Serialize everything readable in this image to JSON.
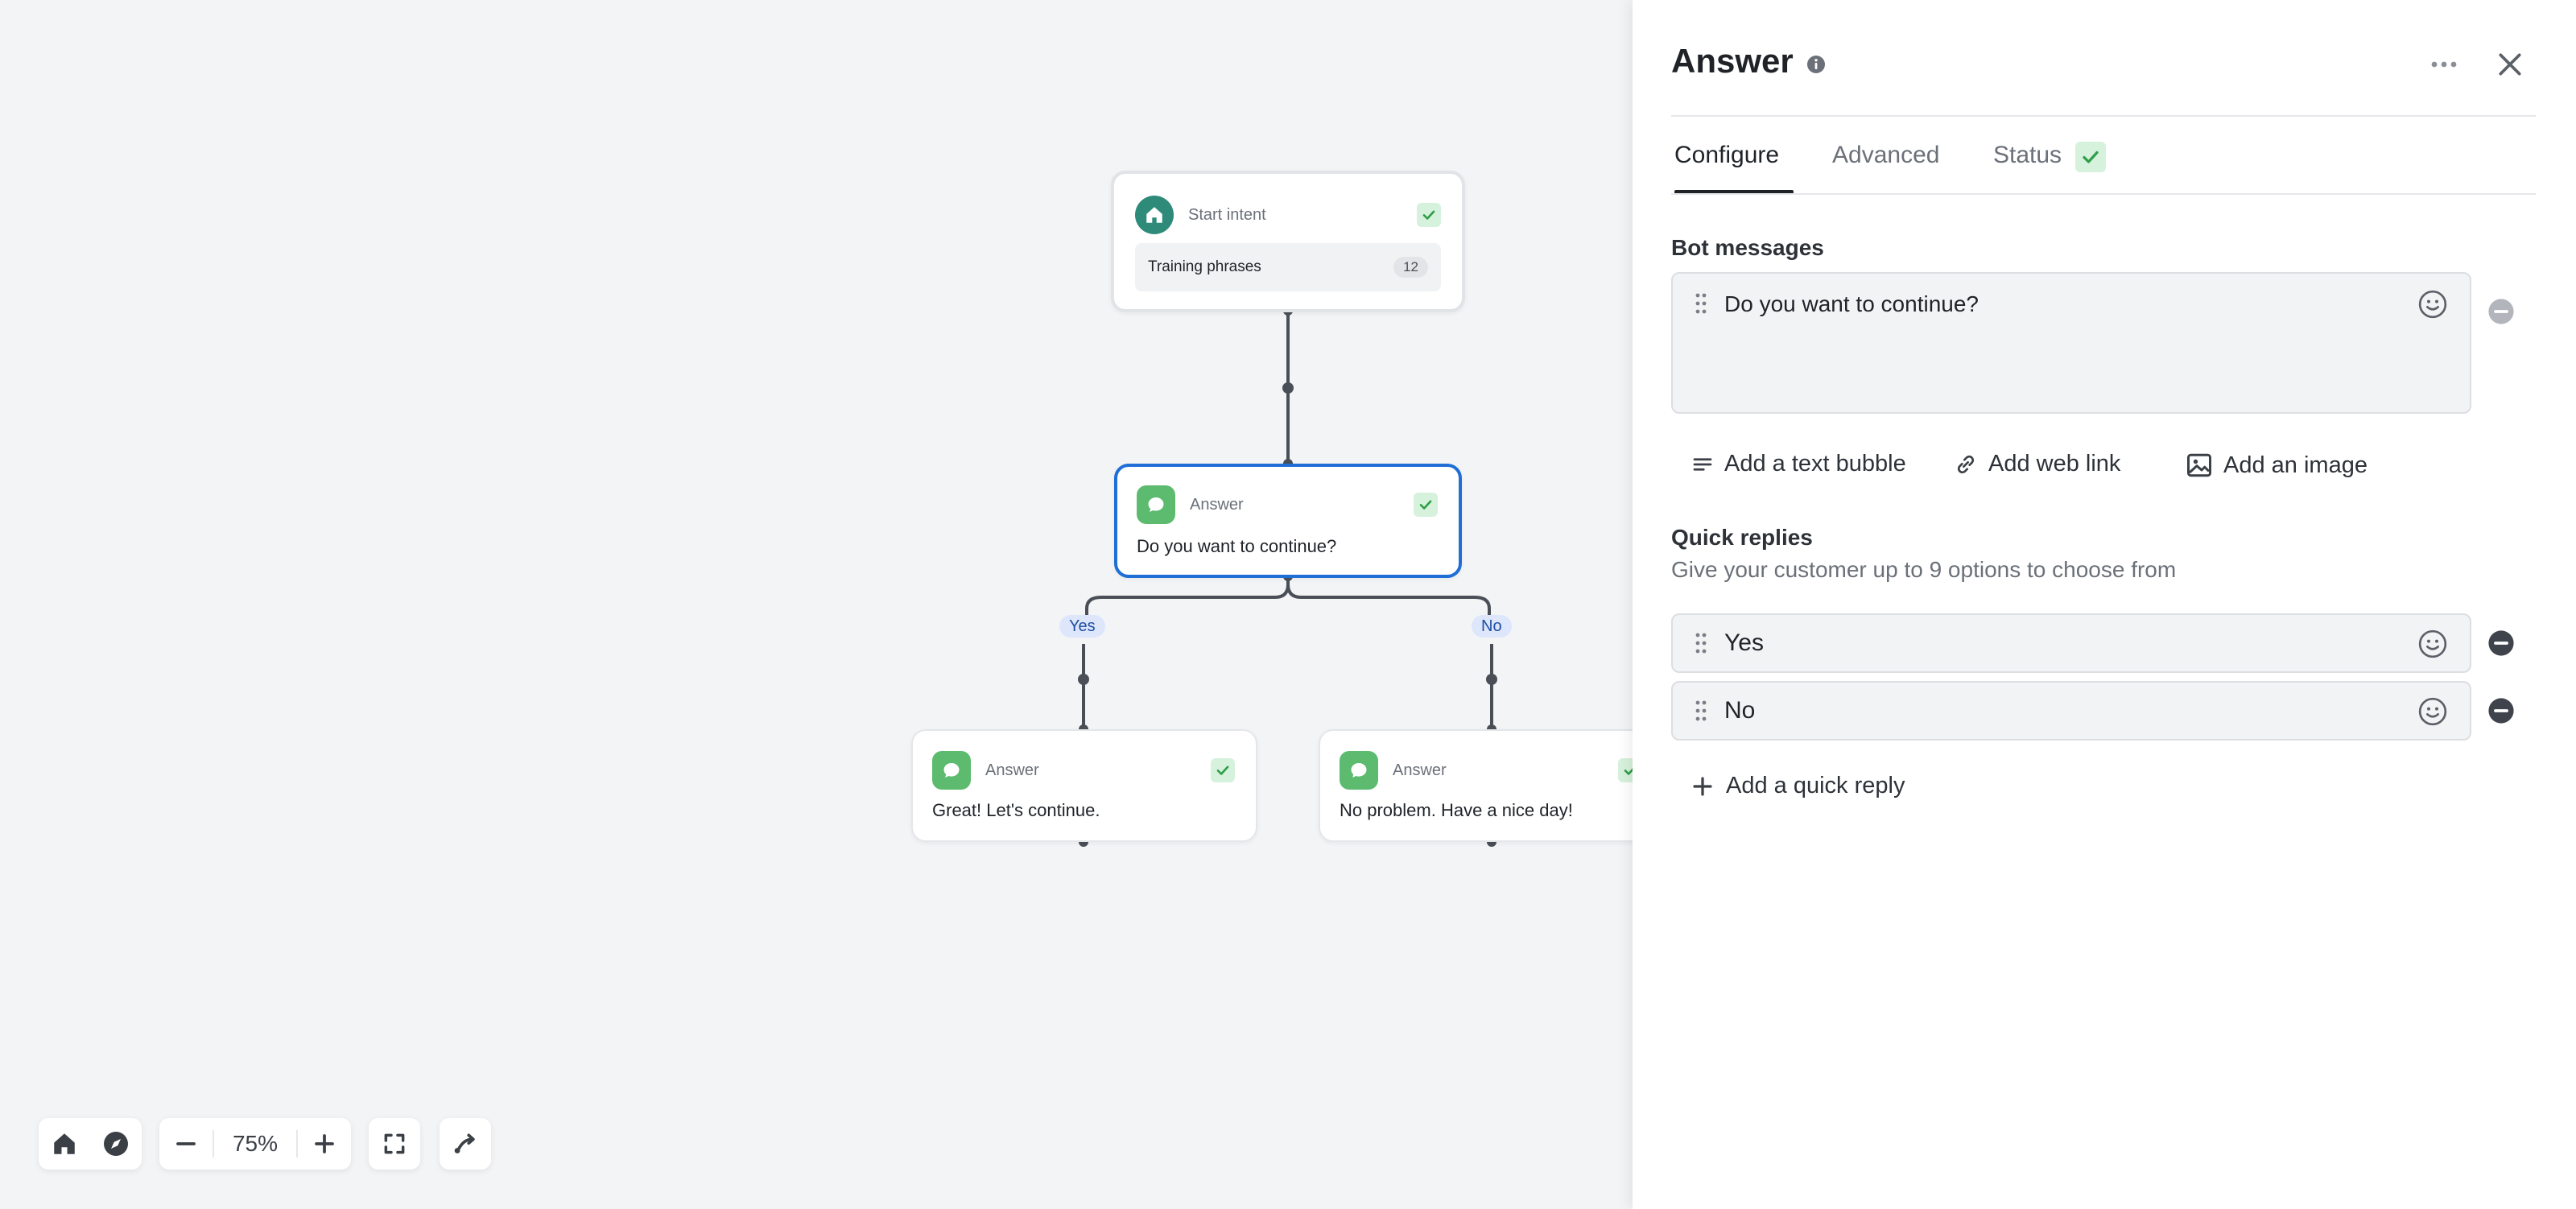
{
  "canvas": {
    "start_node": {
      "type_label": "Start intent",
      "phrases_label": "Training phrases",
      "phrases_count": "12"
    },
    "answer_node": {
      "type_label": "Answer",
      "text": "Do you want to continue?"
    },
    "yes_node": {
      "type_label": "Answer",
      "text": "Great! Let's continue."
    },
    "no_node": {
      "type_label": "Answer",
      "text": "No problem. Have a nice day!"
    },
    "branches": {
      "yes": "Yes",
      "no": "No"
    },
    "zoom": {
      "level": "75%"
    }
  },
  "panel": {
    "title": "Answer",
    "tabs": [
      {
        "label": "Configure"
      },
      {
        "label": "Advanced"
      },
      {
        "label": "Status"
      }
    ],
    "bot_messages": {
      "label": "Bot messages",
      "messages": [
        "Do you want to continue?"
      ]
    },
    "actions": {
      "add_text_bubble": "Add a text bubble",
      "add_web_link": "Add web link",
      "add_image": "Add an image"
    },
    "quick_replies": {
      "label": "Quick replies",
      "subtitle": "Give your customer up to 9 options to choose from",
      "items": [
        "Yes",
        "No"
      ],
      "add_label": "Add a quick reply"
    }
  },
  "colors": {
    "accent": "#1f6fd6",
    "answer_icon": "#5cbb6f",
    "start_icon": "#2e8a79",
    "check_bg": "#d6f1dc",
    "check": "#2f9e48",
    "branch_bg": "#dde6fb"
  }
}
